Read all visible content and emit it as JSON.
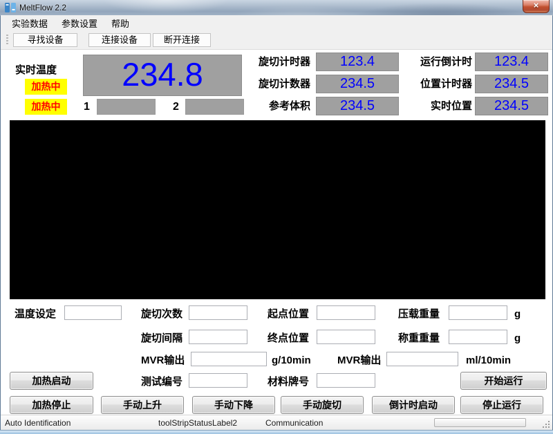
{
  "colors": {
    "accent_blue": "#0000ff",
    "display_gray": "#a0a0a0",
    "heating_bg": "#ffff00",
    "heating_text": "#ff0000"
  },
  "window": {
    "title": "MeltFlow 2.2",
    "close_glyph": "×"
  },
  "menu": {
    "experiment": "实验数据",
    "params": "参数设置",
    "help": "帮助"
  },
  "toolbar": {
    "find": "寻找设备",
    "connect": "连接设备",
    "disconnect": "断开连接"
  },
  "panel": {
    "temp_label": "实时温度",
    "heating_top": "加热中",
    "heating_bottom": "加热中",
    "temp_value": "234.8",
    "ind1": "1",
    "ind2": "2",
    "readouts": {
      "left": [
        {
          "label": "旋切计时器",
          "value": "123.4"
        },
        {
          "label": "旋切计数器",
          "value": "234.5"
        },
        {
          "label": "参考体积",
          "value": "234.5"
        }
      ],
      "right": [
        {
          "label": "运行倒计时",
          "value": "123.4"
        },
        {
          "label": "位置计时器",
          "value": "234.5"
        },
        {
          "label": "实时位置",
          "value": "234.5"
        }
      ]
    }
  },
  "form": {
    "temp_set": {
      "label": "温度设定",
      "value": ""
    },
    "cut_count": {
      "label": "旋切次数",
      "value": ""
    },
    "cut_interval": {
      "label": "旋切间隔",
      "value": ""
    },
    "start_pos": {
      "label": "起点位置",
      "value": ""
    },
    "end_pos": {
      "label": "终点位置",
      "value": ""
    },
    "load_weight": {
      "label": "压载重量",
      "value": "",
      "unit": "g"
    },
    "weigh_weight": {
      "label": "称重重量",
      "value": "",
      "unit": "g"
    },
    "mvr_g": {
      "label": "MVR输出",
      "value": "",
      "unit": "g/10min"
    },
    "mvr_ml": {
      "label": "MVR输出",
      "value": "",
      "unit": "ml/10min"
    },
    "test_no": {
      "label": "测试编号",
      "value": ""
    },
    "material_no": {
      "label": "材料牌号",
      "value": ""
    }
  },
  "buttons": {
    "heat_start": "加热启动",
    "heat_stop": "加热停止",
    "manual_up": "手动上升",
    "manual_down": "手动下降",
    "manual_cut": "手动旋切",
    "countdown_start": "倒计时启动",
    "run_start": "开始运行",
    "run_stop": "停止运行"
  },
  "statusbar": {
    "left": "Auto Identification",
    "middle": "toolStripStatusLabel2",
    "right": "Communication"
  }
}
